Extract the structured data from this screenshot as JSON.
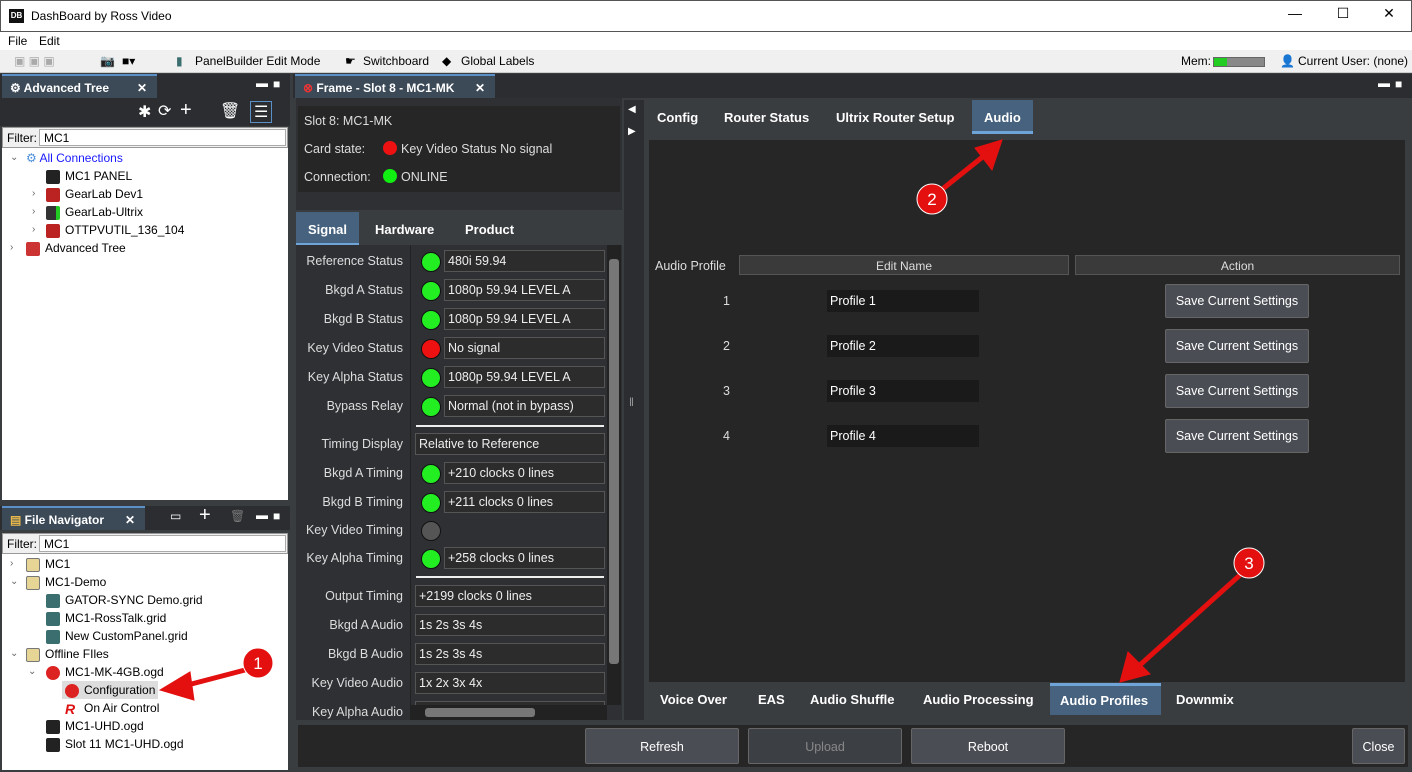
{
  "window": {
    "title": "DashBoard by Ross Video",
    "logo": "DB",
    "minimize": "—",
    "maximize": "☐",
    "close": "✕"
  },
  "menu": [
    "File",
    "Edit"
  ],
  "toolbar": {
    "panelbuilder": "PanelBuilder Edit Mode",
    "switchboard": "Switchboard",
    "global_labels": "Global Labels",
    "mem_label": "Mem:",
    "mem_fraction": 0.25,
    "current_user": "Current User: (none)"
  },
  "advanced_tree": {
    "tab": "Advanced Tree",
    "filter_label": "Filter:",
    "filter_value": "MC1",
    "items": [
      {
        "label": "All Connections"
      },
      {
        "label": "MC1 PANEL"
      },
      {
        "label": "GearLab Dev1"
      },
      {
        "label": "GearLab-Ultrix"
      },
      {
        "label": "OTTPVUTIL_136_104"
      },
      {
        "label": "Advanced Tree"
      }
    ]
  },
  "file_navigator": {
    "tab": "File Navigator",
    "filter_label": "Filter:",
    "filter_value": "MC1",
    "items": [
      {
        "label": "MC1"
      },
      {
        "label": "MC1-Demo"
      },
      {
        "label": "GATOR-SYNC Demo.grid"
      },
      {
        "label": "MC1-RossTalk.grid"
      },
      {
        "label": "New CustomPanel.grid"
      },
      {
        "label": "Offline FIles"
      },
      {
        "label": "MC1-MK-4GB.ogd"
      },
      {
        "label": "Configuration"
      },
      {
        "label": "On Air Control"
      },
      {
        "label": "MC1-UHD.ogd"
      },
      {
        "label": "Slot 11 MC1-UHD.ogd"
      }
    ]
  },
  "frame": {
    "tab": "Frame - Slot 8 - MC1-MK",
    "slot": "Slot 8: MC1-MK",
    "card_state_label": "Card state:",
    "card_state": "Key Video Status No signal",
    "connection_label": "Connection:",
    "connection": "ONLINE"
  },
  "signal_tabs": [
    "Signal",
    "Hardware",
    "Product"
  ],
  "signal_rows": [
    {
      "label": "Reference Status",
      "led": "#22ee22",
      "value": "480i 59.94"
    },
    {
      "label": "Bkgd A Status",
      "led": "#22ee22",
      "value": "1080p 59.94 LEVEL A"
    },
    {
      "label": "Bkgd B Status",
      "led": "#22ee22",
      "value": "1080p 59.94 LEVEL A"
    },
    {
      "label": "Key Video Status",
      "led": "#ee1111",
      "value": "No signal"
    },
    {
      "label": "Key Alpha Status",
      "led": "#22ee22",
      "value": "1080p 59.94 LEVEL A"
    },
    {
      "label": "Bypass Relay",
      "led": "#22ee22",
      "value": "Normal (not in bypass)"
    },
    {
      "label": "Timing Display",
      "value": "Relative to Reference"
    },
    {
      "label": "Bkgd A Timing",
      "led": "#22ee22",
      "value": "+210 clocks 0 lines"
    },
    {
      "label": "Bkgd B Timing",
      "led": "#22ee22",
      "value": "+211 clocks 0 lines"
    },
    {
      "label": "Key Video Timing",
      "led": "#555555",
      "value": ""
    },
    {
      "label": "Key Alpha Timing",
      "led": "#22ee22",
      "value": "+258 clocks 0 lines"
    },
    {
      "label": "Output Timing",
      "value": "+2199 clocks 0 lines"
    },
    {
      "label": "Bkgd A Audio",
      "value": "1s 2s 3s 4s"
    },
    {
      "label": "Bkgd B Audio",
      "value": "1s 2s 3s 4s"
    },
    {
      "label": "Key Video Audio",
      "value": "1x 2x 3x 4x"
    },
    {
      "label": "Key Alpha Audio",
      "value": ""
    }
  ],
  "top_tabs": [
    "Config",
    "Router Status",
    "Ultrix Router Setup",
    "Audio"
  ],
  "audio": {
    "col_profile": "Audio Profile",
    "col_name": "Edit Name",
    "col_action": "Action",
    "profiles": [
      {
        "num": "1",
        "name": "Profile 1",
        "action": "Save Current Settings"
      },
      {
        "num": "2",
        "name": "Profile 2",
        "action": "Save Current Settings"
      },
      {
        "num": "3",
        "name": "Profile 3",
        "action": "Save Current Settings"
      },
      {
        "num": "4",
        "name": "Profile 4",
        "action": "Save Current Settings"
      }
    ]
  },
  "bottom_tabs": [
    "Voice Over",
    "EAS",
    "Audio Shuffle",
    "Audio Processing",
    "Audio Profiles",
    "Downmix"
  ],
  "buttons": {
    "refresh": "Refresh",
    "upload": "Upload",
    "reboot": "Reboot",
    "close": "Close"
  },
  "callouts": [
    "1",
    "2",
    "3"
  ]
}
